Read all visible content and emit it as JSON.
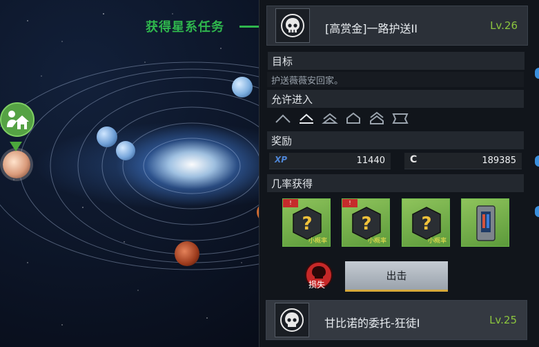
{
  "callout": {
    "text": "获得星系任务"
  },
  "current_mission": {
    "title": "[高赏金]一路护送II",
    "level": "Lv.26"
  },
  "objective": {
    "header": "目标",
    "description": "护送薇薇安回家。"
  },
  "access": {
    "header": "允许进入",
    "ship_classes": [
      "class-1-icon",
      "class-2-icon",
      "class-3-icon",
      "class-4-icon",
      "class-5-icon",
      "class-6-icon"
    ]
  },
  "reward": {
    "header": "奖励",
    "xp_label": "XP",
    "xp_value": "11440",
    "credit_label": "C",
    "credit_value": "189385"
  },
  "drops": {
    "header": "几率获得",
    "items": [
      {
        "name": "mystery-box",
        "chance": "小概率",
        "tagged": true
      },
      {
        "name": "mystery-box",
        "chance": "小概率",
        "tagged": true
      },
      {
        "name": "mystery-box",
        "chance": "小概率",
        "tagged": false
      },
      {
        "name": "equipment-module",
        "chance": "",
        "tagged": false
      }
    ]
  },
  "loss": {
    "label": "损失"
  },
  "action": {
    "sortie_label": "出击"
  },
  "next_mission": {
    "title": "甘比诺的委托-狂徒I",
    "level": "Lv.25"
  },
  "colors": {
    "accent_green": "#2fb64d",
    "level_green": "#8cc63e",
    "button_underline": "#d6a93b",
    "loss_red": "#c62828"
  }
}
